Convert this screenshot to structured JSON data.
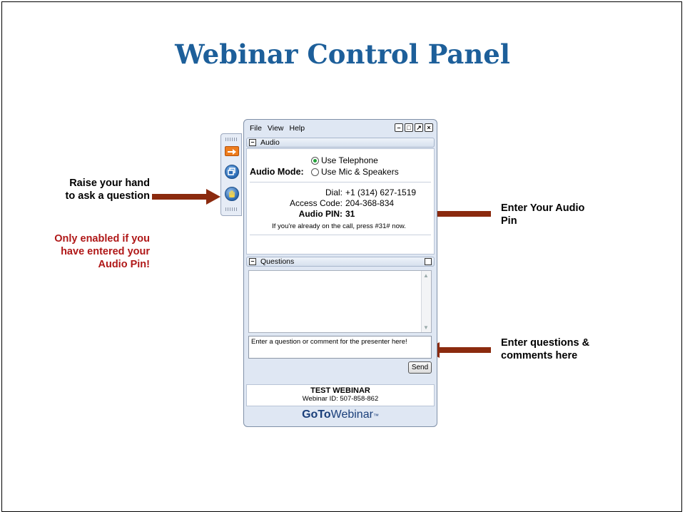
{
  "slide": {
    "title": "Webinar Control Panel"
  },
  "annotations": {
    "raise_hand": "Raise your hand to ask a question",
    "only_enabled": "Only enabled if you have entered your Audio Pin!",
    "enter_pin": "Enter Your Audio Pin",
    "enter_questions": "Enter questions & comments here"
  },
  "colors": {
    "title": "#1d5f9a",
    "warning_text": "#b01818",
    "arrow": "#8b2a0e",
    "panel_bg": "#dfe7f3"
  },
  "side_toolbar": {
    "buttons": [
      {
        "icon": "orange-arrow-icon"
      },
      {
        "icon": "window-restore-icon"
      },
      {
        "icon": "raise-hand-icon"
      }
    ]
  },
  "panel": {
    "menu": [
      "File",
      "View",
      "Help"
    ],
    "audio": {
      "section_title": "Audio",
      "mode_label": "Audio Mode:",
      "options": [
        "Use Telephone",
        "Use Mic & Speakers"
      ],
      "selected": "Use Telephone",
      "dial_label": "Dial:",
      "dial_value": "+1 (314) 627-1519",
      "access_label": "Access Code:",
      "access_value": "204-368-834",
      "pin_label": "Audio PIN:",
      "pin_value": "31",
      "hint": "If you're already on the call, press #31# now."
    },
    "questions": {
      "section_title": "Questions",
      "input_placeholder": "Enter a question or comment for the presenter here!",
      "send_label": "Send"
    },
    "webinar": {
      "name": "TEST WEBINAR",
      "id_text": "Webinar ID: 507-858-862"
    },
    "brand": {
      "bold": "GoTo",
      "normal": "Webinar",
      "tm": "™"
    }
  }
}
